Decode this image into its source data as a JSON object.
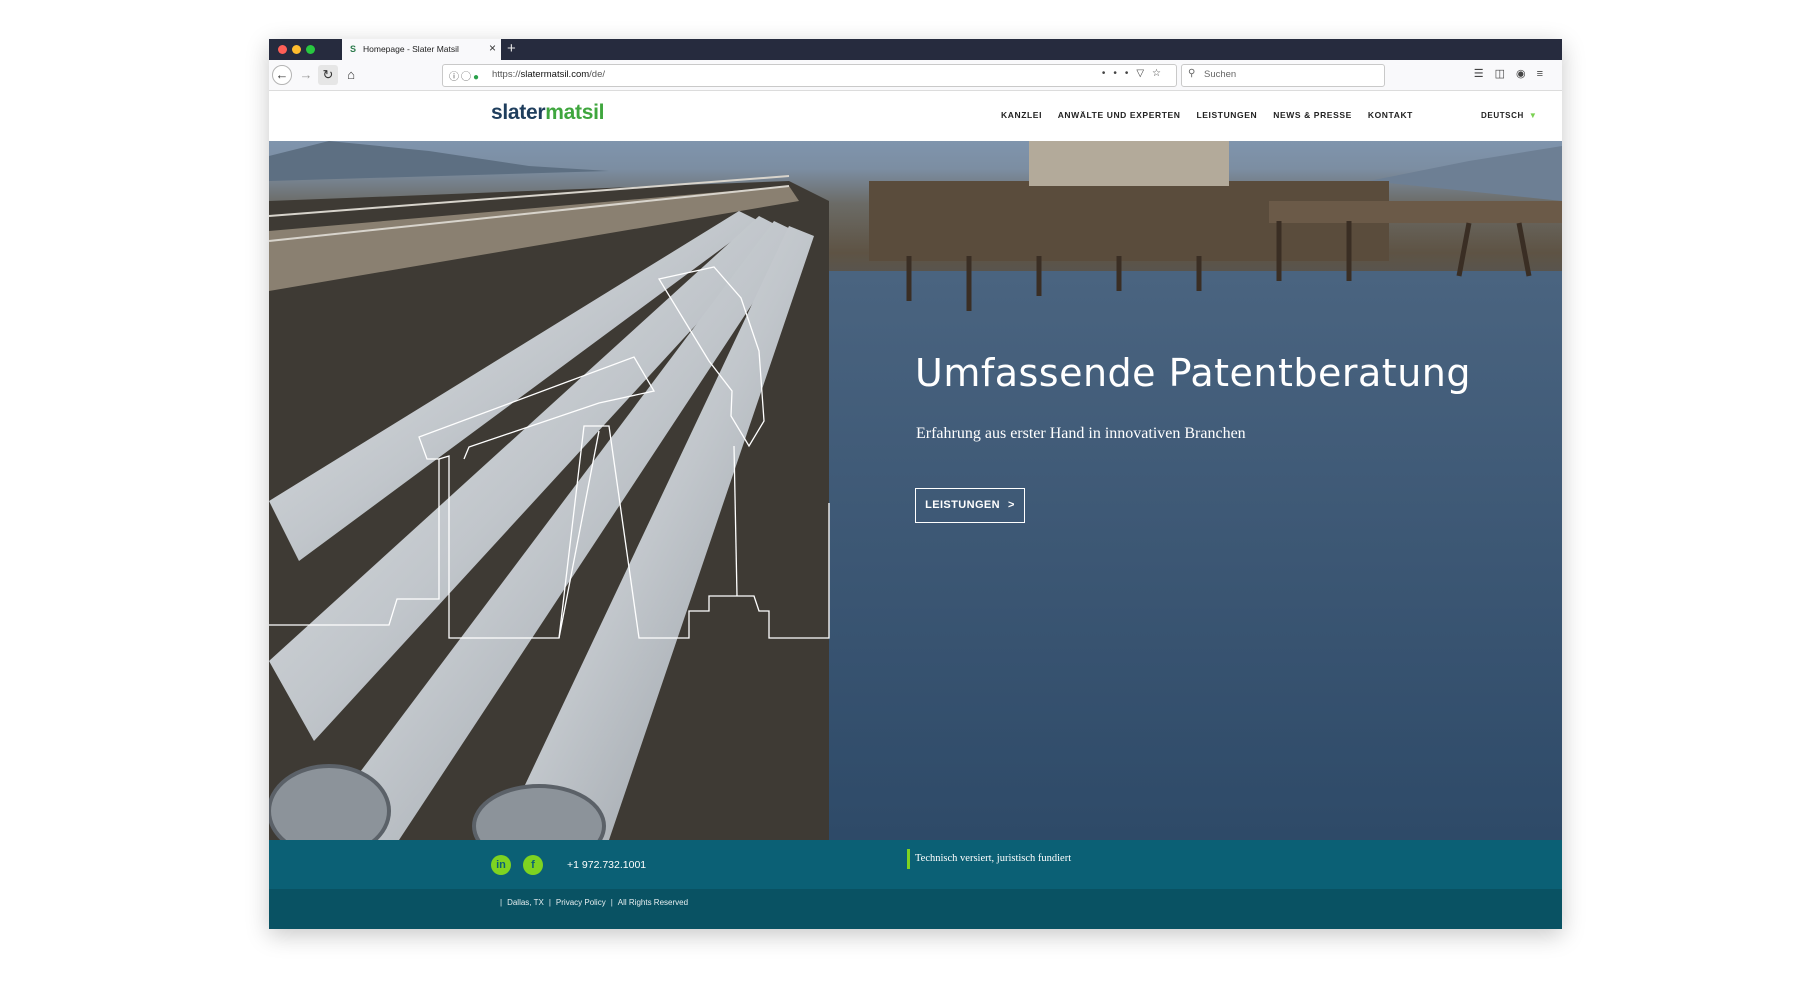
{
  "browser": {
    "tab_title": "Homepage - Slater Matsil",
    "tab_favicon": "S",
    "tab_close": "×",
    "new_tab": "+",
    "url_prefix": "https://",
    "url_domain": "slatermatsil.com",
    "url_path": "/de/",
    "url_more": "•••",
    "search_placeholder": "Suchen",
    "icons": [
      "back-icon",
      "forward-icon",
      "reload-icon",
      "home-icon",
      "info-icon",
      "shield-icon",
      "lock-icon",
      "pocket-icon",
      "bookmark-star-icon",
      "search-icon",
      "library-icon",
      "sidebar-icon",
      "account-icon",
      "menu-icon"
    ]
  },
  "site": {
    "logo_part1": "slater",
    "logo_part2": "matsil",
    "nav": [
      "KANZLEI",
      "ANWÄLTE UND EXPERTEN",
      "LEISTUNGEN",
      "NEWS & PRESSE",
      "KONTAKT"
    ],
    "language": "DEUTSCH",
    "colors": {
      "brand_green": "#3fa63e",
      "brand_navy": "#1f3e5d",
      "footer_teal": "#0b6075",
      "accent_green": "#7ed321"
    }
  },
  "hero": {
    "title": "Umfassende Patentberatung",
    "subtitle": "Erfahrung aus erster Hand in innovativen Branchen",
    "button_label": "LEISTUNGEN",
    "button_arrow": ">"
  },
  "footer": {
    "linkedin_label": "in",
    "facebook_label": "f",
    "phone": "+1 972.732.1001",
    "tagline": "Technisch versiert, juristisch fundiert",
    "links": [
      "Dallas, TX",
      "Privacy Policy",
      "All Rights Reserved"
    ],
    "separator": "|"
  }
}
